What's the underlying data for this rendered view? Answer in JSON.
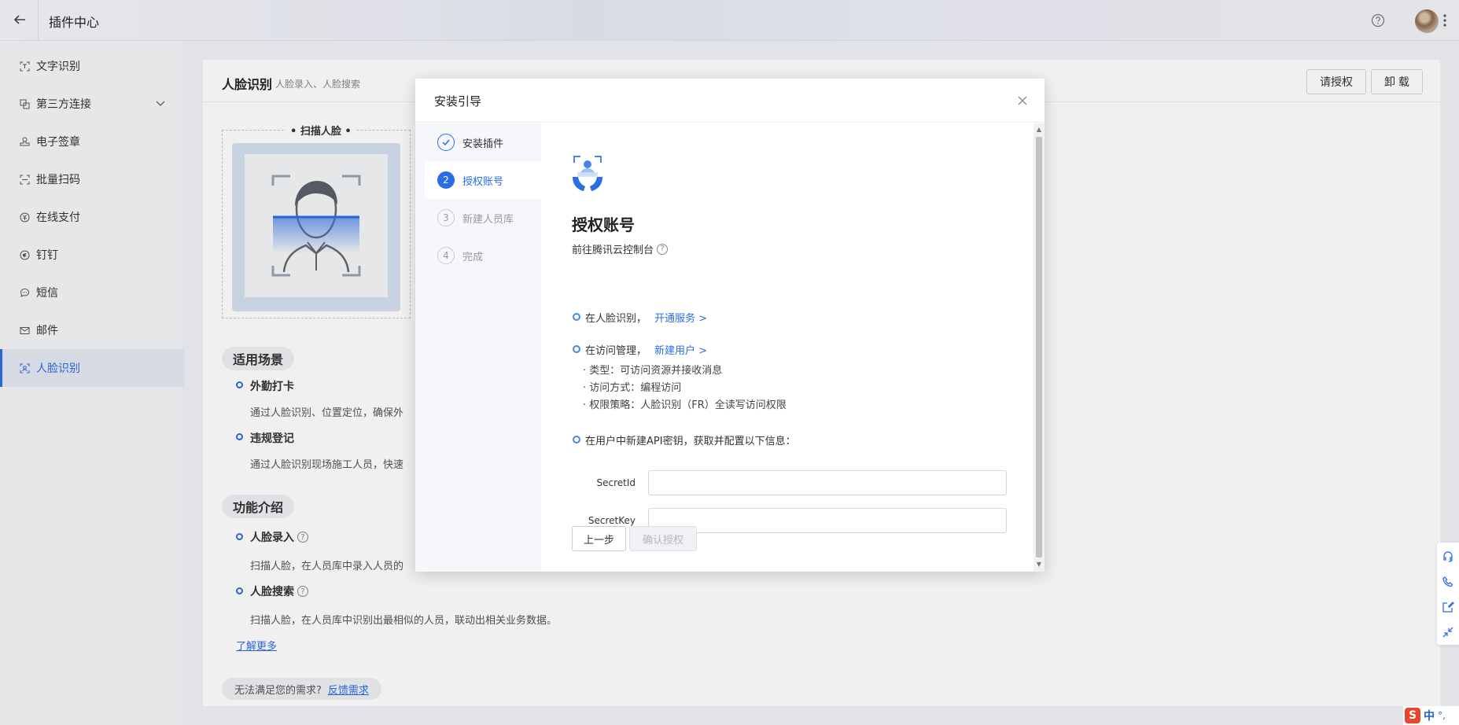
{
  "topbar": {
    "title": "插件中心"
  },
  "sidebar": {
    "items": [
      {
        "label": "文字识别",
        "icon": "text-scan-icon"
      },
      {
        "label": "第三方连接",
        "icon": "link-icon"
      },
      {
        "label": "电子签章",
        "icon": "stamp-icon"
      },
      {
        "label": "批量扫码",
        "icon": "scan-icon"
      },
      {
        "label": "在线支付",
        "icon": "yen-icon"
      },
      {
        "label": "钉钉",
        "icon": "dingtalk-icon"
      },
      {
        "label": "短信",
        "icon": "message-icon"
      },
      {
        "label": "邮件",
        "icon": "mail-icon"
      },
      {
        "label": "人脸识别",
        "icon": "face-scan-icon"
      }
    ],
    "active_index": 8
  },
  "main": {
    "plugin_name": "人脸识别",
    "plugin_subtitle": "人脸录入、人脸搜索",
    "authorize_button": "请授权",
    "uninstall_button": "卸 载",
    "scan_label": "扫描人脸",
    "scenarios_title": "适用场景",
    "scenario1_title": "外勤打卡",
    "scenario1_desc": "通过人脸识别、位置定位，确保外",
    "scenario2_title": "违规登记",
    "scenario2_desc": "通过人脸识别现场施工人员，快速",
    "features_title": "功能介绍",
    "feature1_title": "人脸录入",
    "feature1_desc": "扫描人脸，在人员库中录入人员的",
    "feature2_title": "人脸搜索",
    "feature2_desc": "扫描人脸，在人员库中识别出最相似的人员，联动出相关业务数据。",
    "learn_more": "了解更多",
    "feedback_text": "无法满足您的需求?",
    "feedback_link": "反馈需求"
  },
  "modal": {
    "title": "安装引导",
    "steps": [
      {
        "num": "",
        "label": "安装插件",
        "state": "done"
      },
      {
        "num": "2",
        "label": "授权账号",
        "state": "active"
      },
      {
        "num": "3",
        "label": "新建人员库",
        "state": "pending"
      },
      {
        "num": "4",
        "label": "完成",
        "state": "pending"
      }
    ],
    "content": {
      "title": "授权账号",
      "subtitle": "前往腾讯云控制台",
      "step1_text": "在人脸识别，",
      "step1_link": "开通服务 >",
      "step2_text": "在访问管理，",
      "step2_link": "新建用户 >",
      "step2_detail1": "· 类型：可访问资源并接收消息",
      "step2_detail2": "· 访问方式：编程访问",
      "step2_detail3": "· 权限策略：人脸识别（FR）全读写访问权限",
      "step3_text": "在用户中新建API密钥，获取并配置以下信息：",
      "field1_label": "SecretId",
      "field1_value": "",
      "field2_label": "SecretKey",
      "field2_value": "",
      "prev_button": "上一步",
      "confirm_button": "确认授权"
    }
  },
  "ime": {
    "badge": "S",
    "lang": "中",
    "extra": "°,"
  },
  "colors": {
    "accent": "#2b6de5",
    "sidebar_active_bg": "#e3e8f2"
  }
}
